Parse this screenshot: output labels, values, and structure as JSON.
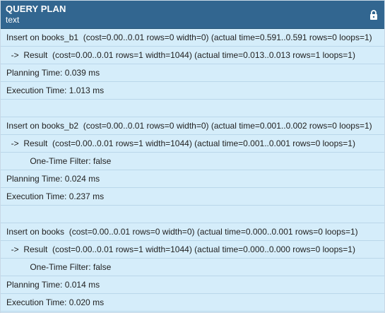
{
  "header": {
    "column_name": "QUERY PLAN",
    "column_type": "text",
    "icon": "lock-icon"
  },
  "rows": [
    "Insert on books_b1  (cost=0.00..0.01 rows=0 width=0) (actual time=0.591..0.591 rows=0 loops=1)",
    "  ->  Result  (cost=0.00..0.01 rows=1 width=1044) (actual time=0.013..0.013 rows=1 loops=1)",
    "Planning Time: 0.039 ms",
    "Execution Time: 1.013 ms",
    "",
    "Insert on books_b2  (cost=0.00..0.01 rows=0 width=0) (actual time=0.001..0.002 rows=0 loops=1)",
    "  ->  Result  (cost=0.00..0.01 rows=1 width=1044) (actual time=0.001..0.001 rows=0 loops=1)",
    "          One-Time Filter: false",
    "Planning Time: 0.024 ms",
    "Execution Time: 0.237 ms",
    "",
    "Insert on books  (cost=0.00..0.01 rows=0 width=0) (actual time=0.000..0.001 rows=0 loops=1)",
    "  ->  Result  (cost=0.00..0.01 rows=1 width=1044) (actual time=0.000..0.000 rows=0 loops=1)",
    "          One-Time Filter: false",
    "Planning Time: 0.014 ms",
    "Execution Time: 0.020 ms"
  ]
}
